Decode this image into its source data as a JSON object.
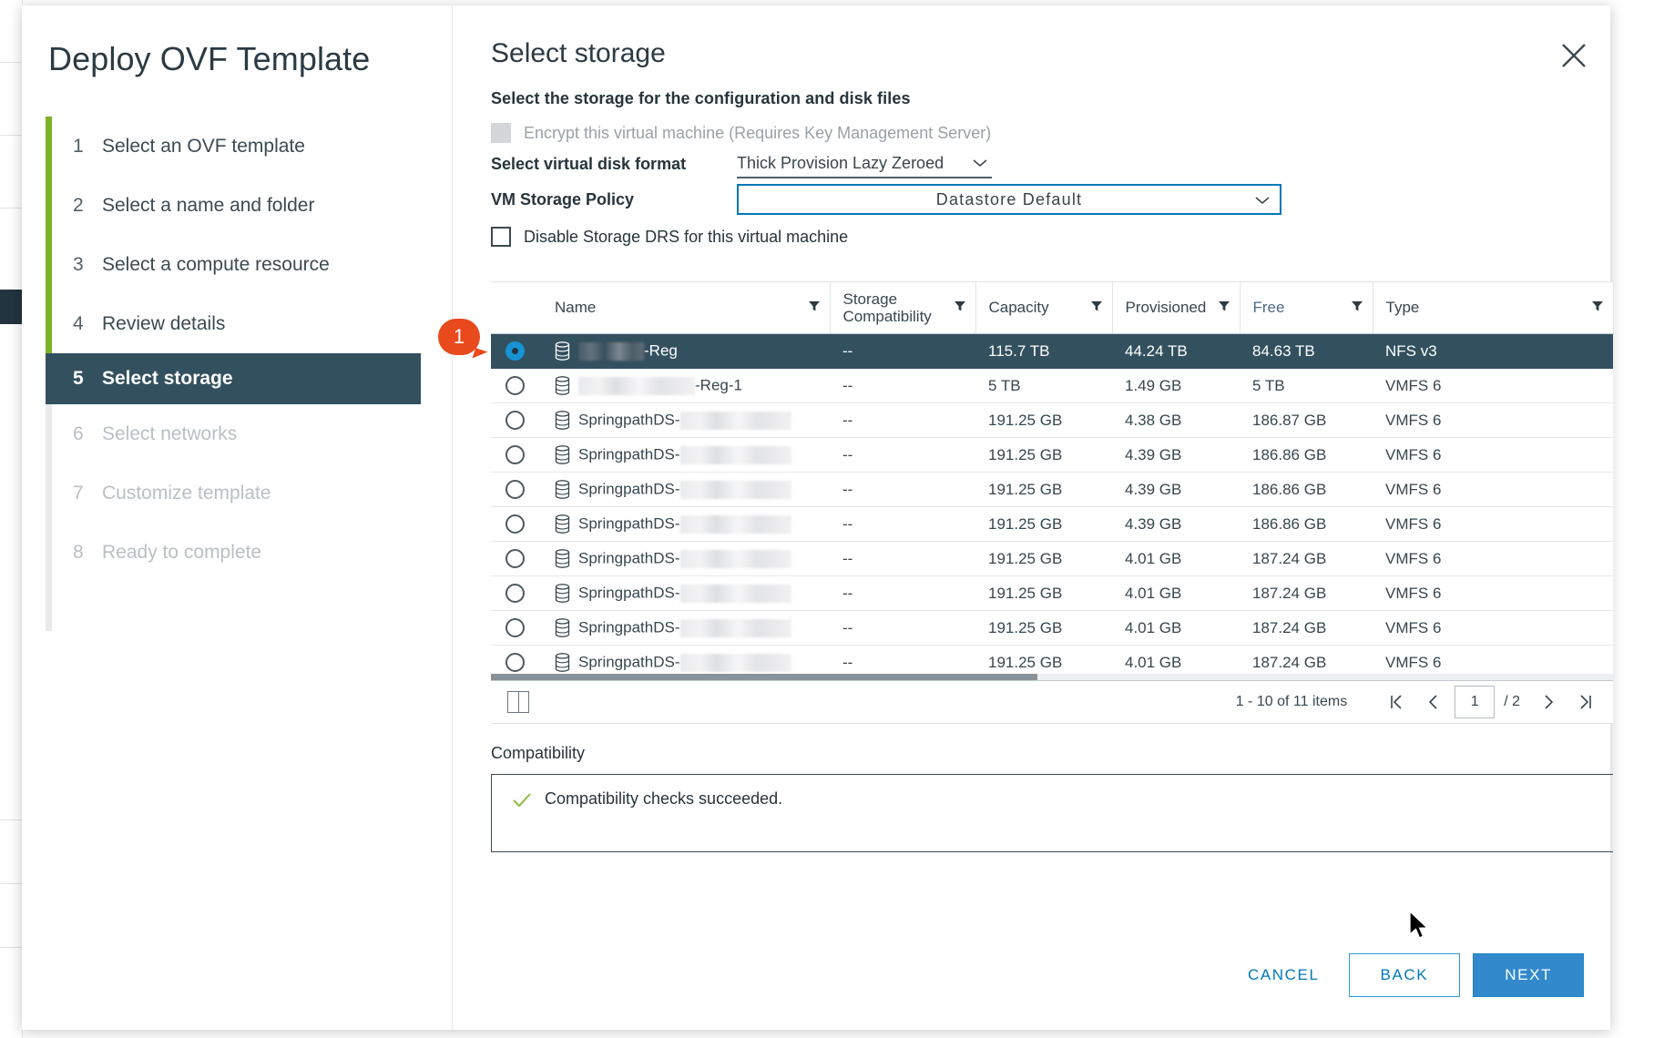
{
  "wizard": {
    "title": "Deploy OVF Template",
    "close_icon": "close-icon",
    "steps": [
      {
        "num": "1",
        "label": "Select an OVF template",
        "state": "done"
      },
      {
        "num": "2",
        "label": "Select a name and folder",
        "state": "done"
      },
      {
        "num": "3",
        "label": "Select a compute resource",
        "state": "done"
      },
      {
        "num": "4",
        "label": "Review details",
        "state": "done"
      },
      {
        "num": "5",
        "label": "Select storage",
        "state": "active"
      },
      {
        "num": "6",
        "label": "Select networks",
        "state": "disabled"
      },
      {
        "num": "7",
        "label": "Customize template",
        "state": "disabled"
      },
      {
        "num": "8",
        "label": "Ready to complete",
        "state": "disabled"
      }
    ]
  },
  "page": {
    "title": "Select storage",
    "subtitle": "Select the storage for the configuration and disk files",
    "encrypt_checkbox_label": "Encrypt this virtual machine (Requires Key Management Server)",
    "disk_format_label": "Select virtual disk format",
    "disk_format_value": "Thick Provision Lazy Zeroed",
    "storage_policy_label": "VM Storage Policy",
    "storage_policy_value": "Datastore Default",
    "disable_drs_label": "Disable Storage DRS for this virtual machine"
  },
  "grid": {
    "columns": [
      "Name",
      "Storage Compatibility",
      "Capacity",
      "Provisioned",
      "Free",
      "Type"
    ],
    "filter_icon": "filter-icon",
    "rows": [
      {
        "selected": true,
        "name_prefix": "",
        "name_suffix": "-Reg",
        "redact": 72,
        "compat": "--",
        "capacity": "115.7 TB",
        "provisioned": "44.24 TB",
        "free": "84.63 TB",
        "type": "NFS v3"
      },
      {
        "selected": false,
        "name_prefix": "",
        "name_suffix": "-Reg-1",
        "redact": 128,
        "compat": "--",
        "capacity": "5 TB",
        "provisioned": "1.49 GB",
        "free": "5 TB",
        "type": "VMFS 6"
      },
      {
        "selected": false,
        "name_prefix": "SpringpathDS-",
        "name_suffix": "",
        "redact": 122,
        "compat": "--",
        "capacity": "191.25 GB",
        "provisioned": "4.38 GB",
        "free": "186.87 GB",
        "type": "VMFS 6"
      },
      {
        "selected": false,
        "name_prefix": "SpringpathDS-",
        "name_suffix": "",
        "redact": 122,
        "compat": "--",
        "capacity": "191.25 GB",
        "provisioned": "4.39 GB",
        "free": "186.86 GB",
        "type": "VMFS 6"
      },
      {
        "selected": false,
        "name_prefix": "SpringpathDS-",
        "name_suffix": "",
        "redact": 122,
        "compat": "--",
        "capacity": "191.25 GB",
        "provisioned": "4.39 GB",
        "free": "186.86 GB",
        "type": "VMFS 6"
      },
      {
        "selected": false,
        "name_prefix": "SpringpathDS-",
        "name_suffix": "",
        "redact": 122,
        "compat": "--",
        "capacity": "191.25 GB",
        "provisioned": "4.39 GB",
        "free": "186.86 GB",
        "type": "VMFS 6"
      },
      {
        "selected": false,
        "name_prefix": "SpringpathDS-",
        "name_suffix": "",
        "redact": 122,
        "compat": "--",
        "capacity": "191.25 GB",
        "provisioned": "4.01 GB",
        "free": "187.24 GB",
        "type": "VMFS 6"
      },
      {
        "selected": false,
        "name_prefix": "SpringpathDS-",
        "name_suffix": "",
        "redact": 122,
        "compat": "--",
        "capacity": "191.25 GB",
        "provisioned": "4.01 GB",
        "free": "187.24 GB",
        "type": "VMFS 6"
      },
      {
        "selected": false,
        "name_prefix": "SpringpathDS-",
        "name_suffix": "",
        "redact": 122,
        "compat": "--",
        "capacity": "191.25 GB",
        "provisioned": "4.01 GB",
        "free": "187.24 GB",
        "type": "VMFS 6"
      },
      {
        "selected": false,
        "name_prefix": "SpringpathDS-",
        "name_suffix": "",
        "redact": 122,
        "compat": "--",
        "capacity": "191.25 GB",
        "provisioned": "4.01 GB",
        "free": "187.24 GB",
        "type": "VMFS 6"
      }
    ],
    "pager": {
      "items_text": "1 - 10 of 11 items",
      "items_count": "11",
      "first_icon": "first-page-icon",
      "prev_icon": "prev-page-icon",
      "current_page": "1",
      "total_pages": "/ 2",
      "next_icon": "next-page-icon",
      "last_icon": "last-page-icon",
      "column_chooser_icon": "column-chooser-icon"
    }
  },
  "compatibility": {
    "label": "Compatibility",
    "status_icon": "check-icon",
    "message": "Compatibility checks succeeded."
  },
  "footer": {
    "cancel": "CANCEL",
    "back": "BACK",
    "next": "NEXT"
  },
  "annotation": {
    "badge": "1"
  },
  "colors": {
    "accent_blue": "#0079b8",
    "primary_button": "#3289cc",
    "active_step": "#33505f",
    "progress_green": "#7cb326",
    "badge_orange": "#e8491d",
    "success_green": "#8cbd3f"
  }
}
